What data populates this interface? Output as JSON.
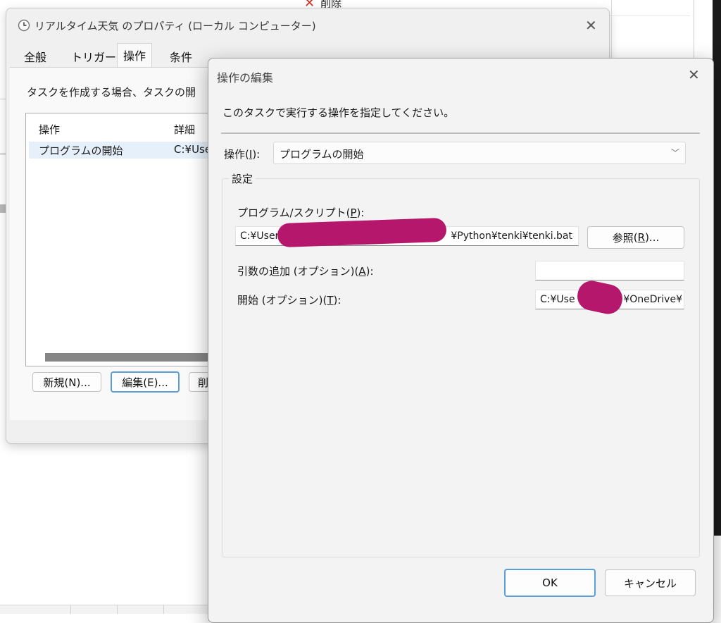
{
  "background": {
    "delete_label": "削除"
  },
  "properties_window": {
    "title": "リアルタイム天気 のプロパティ (ローカル コンピューター)",
    "tabs": [
      "全般",
      "トリガー",
      "操作",
      "条件"
    ],
    "active_tab": "操作",
    "description": "タスクを作成する場合、タスクの開",
    "list_headers": [
      "操作",
      "詳細"
    ],
    "list_rows": [
      {
        "action": "プログラムの開始",
        "detail": "C:¥Use"
      }
    ],
    "buttons": {
      "new": "新規(N)...",
      "edit": "編集(E)...",
      "delete_partial": "削"
    }
  },
  "edit_dialog": {
    "title": "操作の編集",
    "instruction": "このタスクで実行する操作を指定してください。",
    "operation_label": "操作",
    "operation_key": "I",
    "operation_value": "プログラムの開始",
    "settings_label": "設定",
    "program_label": "プログラム/スクリプト",
    "program_key": "P",
    "program_value_left": "C:¥User",
    "program_value_right": "¥Python¥tenki¥tenki.bat",
    "browse_label": "参照",
    "browse_key": "R",
    "args_label": "引数の追加 (オプション)",
    "args_key": "A",
    "args_value": "",
    "start_label": "開始 (オプション)",
    "start_key": "T",
    "start_value_left": "C:¥Use",
    "start_value_right": "¥OneDrive¥",
    "ok_label": "OK",
    "cancel_label": "キャンセル"
  },
  "colors": {
    "redaction": "#b5176c",
    "default_button_border": "#5c9ed9",
    "selection": "#e5f0fb"
  }
}
